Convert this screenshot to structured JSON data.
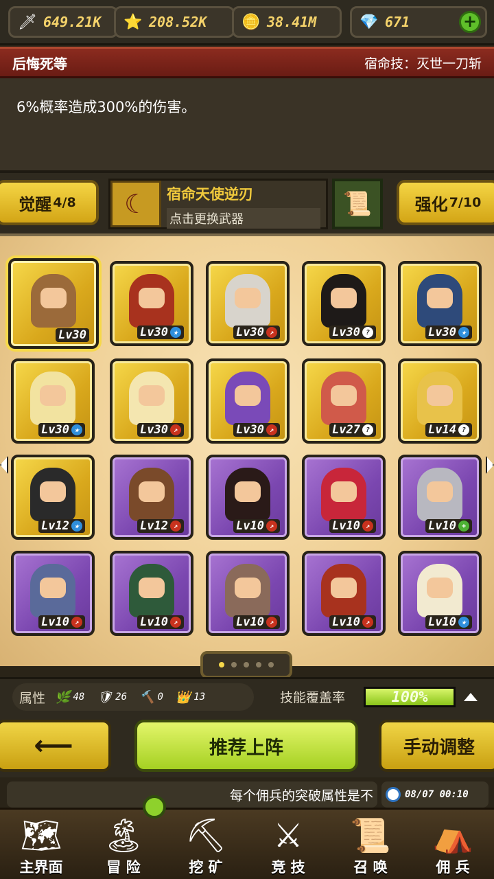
{
  "resources": [
    {
      "icon": "🗡",
      "value": "649.21K",
      "name": "power"
    },
    {
      "icon": "⭐",
      "value": "208.52K",
      "name": "exp"
    },
    {
      "icon": "🪙",
      "value": "38.41M",
      "name": "gold"
    },
    {
      "icon": "💎",
      "value": "671",
      "name": "gems"
    }
  ],
  "skill": {
    "hero_name": "后悔死等",
    "fate_skill": "宿命技：灭世一刀斩",
    "description": "6%概率造成300%的伤害。"
  },
  "weapon_row": {
    "awaken_label": "觉醒",
    "awaken_value": "4/8",
    "weapon_name": "宿命天使逆刃",
    "weapon_hint": "点击更换武器",
    "enhance_label": "强化",
    "enhance_value": "7/10"
  },
  "heroes": [
    {
      "lv": "Lv30",
      "rarity": "gold",
      "badge": "",
      "color": "#9b6a3a"
    },
    {
      "lv": "Lv30",
      "rarity": "gold",
      "badge": "star",
      "color": "#a8321e"
    },
    {
      "lv": "Lv30",
      "rarity": "gold",
      "badge": "red",
      "color": "#d8d4cc"
    },
    {
      "lv": "Lv30",
      "rarity": "gold",
      "badge": "q",
      "color": "#1e1a18"
    },
    {
      "lv": "Lv30",
      "rarity": "gold",
      "badge": "star",
      "color": "#2e4a7a"
    },
    {
      "lv": "Lv30",
      "rarity": "gold",
      "badge": "star",
      "color": "#f2e3a0"
    },
    {
      "lv": "Lv30",
      "rarity": "gold",
      "badge": "red",
      "color": "#f4e6b0"
    },
    {
      "lv": "Lv30",
      "rarity": "gold",
      "badge": "red",
      "color": "#7a4ab8"
    },
    {
      "lv": "Lv27",
      "rarity": "gold",
      "badge": "q",
      "color": "#d05a4a"
    },
    {
      "lv": "Lv14",
      "rarity": "gold",
      "badge": "q",
      "color": "#e8c24a"
    },
    {
      "lv": "Lv12",
      "rarity": "gold",
      "badge": "star",
      "color": "#2a2a2a"
    },
    {
      "lv": "Lv12",
      "rarity": "purple",
      "badge": "red",
      "color": "#7a4a2a"
    },
    {
      "lv": "Lv10",
      "rarity": "purple",
      "badge": "red",
      "color": "#2a1a18"
    },
    {
      "lv": "Lv10",
      "rarity": "purple",
      "badge": "red",
      "color": "#c8263a"
    },
    {
      "lv": "Lv10",
      "rarity": "purple",
      "badge": "plus",
      "color": "#b8b8c0"
    },
    {
      "lv": "Lv10",
      "rarity": "purple",
      "badge": "red",
      "color": "#5a6a9a"
    },
    {
      "lv": "Lv10",
      "rarity": "purple",
      "badge": "red",
      "color": "#2e5a3a"
    },
    {
      "lv": "Lv10",
      "rarity": "purple",
      "badge": "red",
      "color": "#8a6a5a"
    },
    {
      "lv": "Lv10",
      "rarity": "purple",
      "badge": "red",
      "color": "#a8321e"
    },
    {
      "lv": "Lv10",
      "rarity": "purple",
      "badge": "star",
      "color": "#f2ead0"
    }
  ],
  "pager": {
    "total": 5,
    "active": 0
  },
  "attributes": {
    "label": "属性",
    "items": [
      {
        "icon": "🌿",
        "value": "48"
      },
      {
        "icon": "🛡",
        "value": "26"
      },
      {
        "icon": "🔨",
        "value": "0"
      },
      {
        "icon": "👑",
        "value": "13"
      }
    ],
    "coverage_label": "技能覆盖率",
    "coverage_value": "100%",
    "coverage_fraction": 1.0
  },
  "actions": {
    "back_label": "⟵",
    "recommend_label": "推荐上阵",
    "manual_label": "手动调整"
  },
  "ticker": {
    "text": "每个佣兵的突破属性是不",
    "time": "08/07 00:10"
  },
  "nav": [
    {
      "label": "主界面",
      "icon": "🗺"
    },
    {
      "label": "冒 险",
      "icon": "🏝"
    },
    {
      "label": "挖 矿",
      "icon": "⛏"
    },
    {
      "label": "竞 技",
      "icon": "⚔"
    },
    {
      "label": "召 唤",
      "icon": "📜"
    },
    {
      "label": "佣 兵",
      "icon": "⛺"
    }
  ]
}
